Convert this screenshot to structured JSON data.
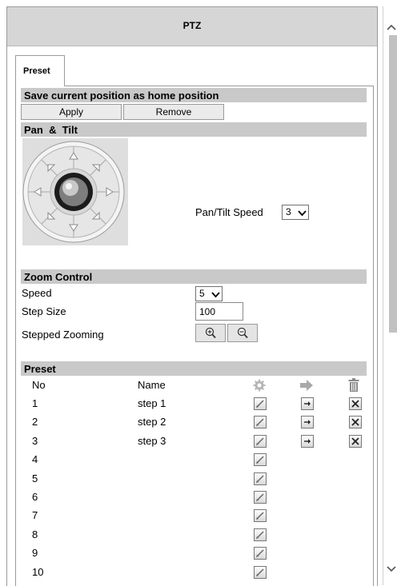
{
  "window": {
    "title": "PTZ"
  },
  "tabs": [
    {
      "label": "Preset",
      "active": true
    }
  ],
  "home_section": {
    "title": "Save current position as home position",
    "apply_label": "Apply",
    "remove_label": "Remove"
  },
  "pantilt_section": {
    "title": "Pan  &  Tilt",
    "speed_label": "Pan/Tilt Speed",
    "speed_value": "3"
  },
  "zoom_section": {
    "title": "Zoom Control",
    "speed_label": "Speed",
    "speed_value": "5",
    "step_size_label": "Step Size",
    "step_size_value": "100",
    "stepped_label": "Stepped Zooming"
  },
  "preset_section": {
    "title": "Preset",
    "col_no": "No",
    "col_name": "Name",
    "rows": [
      {
        "no": "1",
        "name": "step 1",
        "has_goto": true,
        "has_delete": true
      },
      {
        "no": "2",
        "name": "step 2",
        "has_goto": true,
        "has_delete": true
      },
      {
        "no": "3",
        "name": "step 3",
        "has_goto": true,
        "has_delete": true
      },
      {
        "no": "4",
        "name": "",
        "has_goto": false,
        "has_delete": false
      },
      {
        "no": "5",
        "name": "",
        "has_goto": false,
        "has_delete": false
      },
      {
        "no": "6",
        "name": "",
        "has_goto": false,
        "has_delete": false
      },
      {
        "no": "7",
        "name": "",
        "has_goto": false,
        "has_delete": false
      },
      {
        "no": "8",
        "name": "",
        "has_goto": false,
        "has_delete": false
      },
      {
        "no": "9",
        "name": "",
        "has_goto": false,
        "has_delete": false
      },
      {
        "no": "10",
        "name": "",
        "has_goto": false,
        "has_delete": false
      }
    ]
  },
  "icons": {
    "settings": "gear-icon",
    "goto": "arrow-right-icon",
    "delete": "trash-icon",
    "zoom_in": "zoom-in-icon",
    "zoom_out": "zoom-out-icon"
  },
  "colors": {
    "section_header": "#c9c9c9",
    "title_bar": "#d6d6d6",
    "button": "#ebebeb",
    "scrollbar_thumb": "#c1c1c1"
  }
}
